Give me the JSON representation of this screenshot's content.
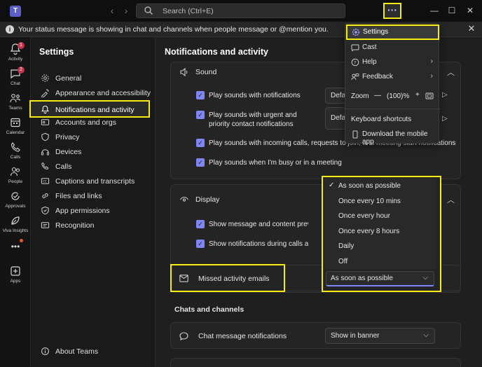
{
  "titlebar": {
    "logo": "T",
    "search_placeholder": "Search (Ctrl+E)",
    "more_label": "···"
  },
  "banner": {
    "text": "Your status message is showing in chat and channels when people message or @mention you."
  },
  "appbar": {
    "items": [
      {
        "label": "Activity",
        "icon": "bell-icon",
        "badge": "1"
      },
      {
        "label": "Chat",
        "icon": "chat-icon",
        "badge": "2"
      },
      {
        "label": "Teams",
        "icon": "teams-icon"
      },
      {
        "label": "Calendar",
        "icon": "calendar-icon"
      },
      {
        "label": "Calls",
        "icon": "phone-icon"
      },
      {
        "label": "People",
        "icon": "people-icon"
      },
      {
        "label": "Approvals",
        "icon": "approvals-icon"
      },
      {
        "label": "Viva Insights",
        "icon": "viva-insights-icon"
      },
      {
        "label": "",
        "icon": "more-apps-icon"
      },
      {
        "label": "Apps",
        "icon": "apps-icon"
      }
    ]
  },
  "sidebar": {
    "heading": "Settings",
    "items": [
      {
        "label": "General",
        "icon": "gear-icon"
      },
      {
        "label": "Appearance and accessibility",
        "icon": "brush-icon"
      },
      {
        "label": "Notifications and activity",
        "icon": "bell-icon"
      },
      {
        "label": "Accounts and orgs",
        "icon": "accounts-icon"
      },
      {
        "label": "Privacy",
        "icon": "shield-icon"
      },
      {
        "label": "Devices",
        "icon": "devices-icon"
      },
      {
        "label": "Calls",
        "icon": "phone-icon"
      },
      {
        "label": "Captions and transcripts",
        "icon": "captions-icon"
      },
      {
        "label": "Files and links",
        "icon": "link-icon"
      },
      {
        "label": "App permissions",
        "icon": "shield-check-icon"
      },
      {
        "label": "Recognition",
        "icon": "recognition-icon"
      }
    ],
    "about": "About Teams"
  },
  "main": {
    "title": "Notifications and activity",
    "sound": {
      "title": "Sound",
      "options": [
        "Play sounds with notifications",
        "Play sounds with urgent and priority contact notifications",
        "Play sounds with incoming calls, requests to join, and meeting start notifications",
        "Play sounds when I'm busy or in a meeting"
      ],
      "select1": "Defau",
      "select2": "Defau"
    },
    "display": {
      "title": "Display",
      "options": [
        "Show message and content previews in notifications",
        "Show notifications during calls and meetings"
      ]
    },
    "missed": {
      "label": "Missed activity emails",
      "value": "As soon as possible"
    },
    "chats_heading": "Chats and channels",
    "chat_notif": {
      "label": "Chat message notifications",
      "value": "Show in banner"
    }
  },
  "more_menu": {
    "settings": "Settings",
    "cast": "Cast",
    "help": "Help",
    "feedback": "Feedback",
    "zoom_label": "Zoom",
    "zoom_minus": "—",
    "zoom_value": "(100)%",
    "zoom_plus": "+",
    "shortcuts": "Keyboard shortcuts",
    "download": "Download the mobile app"
  },
  "dropdown": {
    "options": [
      "As soon as possible",
      "Once every 10 mins",
      "Once every hour",
      "Once every 8 hours",
      "Daily",
      "Off"
    ],
    "selected": "As soon as possible"
  },
  "colors": {
    "accent": "#7f85f5",
    "highlight": "#f5ec12",
    "badge": "#c4314b"
  }
}
